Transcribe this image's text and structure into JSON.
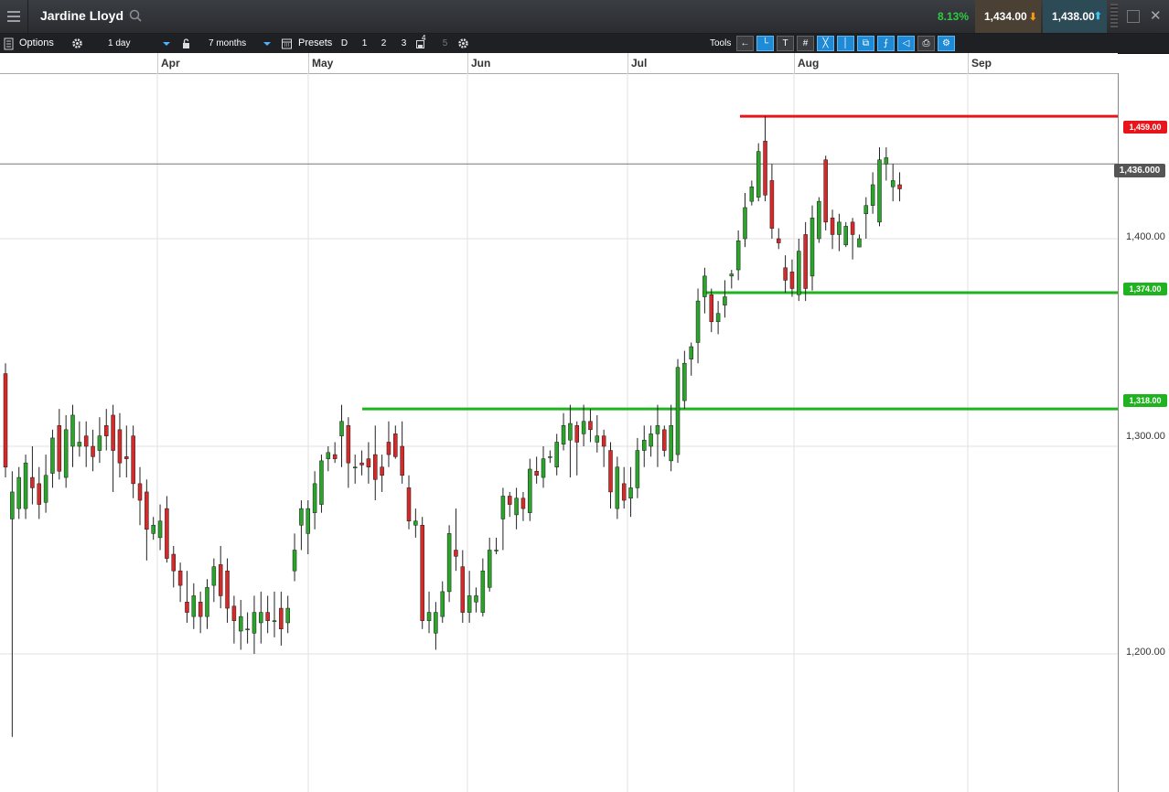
{
  "header": {
    "instrument": "Jardine Lloyd",
    "change_pct": "8.13%",
    "sell_price": "1,434.00",
    "buy_price": "1,438.00"
  },
  "toolbar": {
    "options_label": "Options",
    "interval": "1 day",
    "period": "7 months",
    "presets_label": "Presets",
    "presets": [
      "D",
      "1",
      "2",
      "3",
      "4",
      "5"
    ],
    "tools_label": "Tools"
  },
  "chart_data": {
    "type": "candlestick",
    "x_axis": {
      "months": [
        "Apr",
        "May",
        "Jun",
        "Jul",
        "Aug",
        "Sep"
      ]
    },
    "y_axis": {
      "tick_labels": [
        "1,400.00",
        "1,300.00",
        "1,200.00"
      ],
      "range": [
        1150,
        1500
      ]
    },
    "horizontal_lines": [
      {
        "label": "1,459.00",
        "value": 1459,
        "color": "#e8141b"
      },
      {
        "label": "1,374.00",
        "value": 1374,
        "color": "#1fb41f"
      },
      {
        "label": "1,318.00",
        "value": 1318,
        "color": "#1fb41f"
      }
    ],
    "current_price": {
      "label": "1,436.000",
      "value": 1436
    },
    "candles": [
      [
        1335,
        1290,
        1340,
        1285
      ],
      [
        1265,
        1278,
        1288,
        1160
      ],
      [
        1270,
        1285,
        1290,
        1265
      ],
      [
        1270,
        1292,
        1296,
        1265
      ],
      [
        1285,
        1280,
        1300,
        1272
      ],
      [
        1282,
        1272,
        1290,
        1265
      ],
      [
        1273,
        1286,
        1296,
        1268
      ],
      [
        1287,
        1304,
        1308,
        1280
      ],
      [
        1310,
        1288,
        1318,
        1284
      ],
      [
        1285,
        1308,
        1315,
        1280
      ],
      [
        1300,
        1315,
        1320,
        1290
      ],
      [
        1300,
        1302,
        1312,
        1295
      ],
      [
        1305,
        1300,
        1312,
        1290
      ],
      [
        1300,
        1295,
        1308,
        1288
      ],
      [
        1298,
        1305,
        1314,
        1292
      ],
      [
        1310,
        1305,
        1318,
        1298
      ],
      [
        1315,
        1298,
        1320,
        1278
      ],
      [
        1308,
        1292,
        1316,
        1285
      ],
      [
        1295,
        1294,
        1310,
        1285
      ],
      [
        1305,
        1282,
        1310,
        1275
      ],
      [
        1282,
        1274,
        1290,
        1262
      ],
      [
        1278,
        1260,
        1284,
        1245
      ],
      [
        1258,
        1262,
        1266,
        1255
      ],
      [
        1256,
        1264,
        1272,
        1250
      ],
      [
        1270,
        1246,
        1276,
        1244
      ],
      [
        1248,
        1240,
        1252,
        1232
      ],
      [
        1240,
        1233,
        1244,
        1225
      ],
      [
        1225,
        1220,
        1240,
        1215
      ],
      [
        1218,
        1228,
        1234,
        1212
      ],
      [
        1225,
        1218,
        1230,
        1210
      ],
      [
        1218,
        1232,
        1236,
        1212
      ],
      [
        1233,
        1242,
        1246,
        1225
      ],
      [
        1243,
        1228,
        1252,
        1222
      ],
      [
        1240,
        1222,
        1246,
        1215
      ],
      [
        1223,
        1216,
        1228,
        1205
      ],
      [
        1211,
        1218,
        1226,
        1202
      ],
      [
        1212,
        1212,
        1220,
        1205
      ],
      [
        1210,
        1220,
        1228,
        1200
      ],
      [
        1215,
        1220,
        1230,
        1205
      ],
      [
        1220,
        1216,
        1228,
        1210
      ],
      [
        1216,
        1216,
        1230,
        1208
      ],
      [
        1222,
        1212,
        1230,
        1204
      ],
      [
        1215,
        1222,
        1228,
        1210
      ],
      [
        1240,
        1250,
        1258,
        1235
      ],
      [
        1262,
        1270,
        1274,
        1250
      ],
      [
        1258,
        1270,
        1274,
        1248
      ],
      [
        1268,
        1282,
        1288,
        1260
      ],
      [
        1272,
        1293,
        1296,
        1268
      ],
      [
        1294,
        1297,
        1300,
        1288
      ],
      [
        1296,
        1294,
        1302,
        1292
      ],
      [
        1305,
        1312,
        1320,
        1290
      ],
      [
        1310,
        1292,
        1314,
        1280
      ],
      [
        1290,
        1290,
        1296,
        1282
      ],
      [
        1292,
        1291,
        1298,
        1286
      ],
      [
        1294,
        1290,
        1302,
        1282
      ],
      [
        1296,
        1284,
        1310,
        1274
      ],
      [
        1290,
        1286,
        1296,
        1278
      ],
      [
        1302,
        1296,
        1312,
        1290
      ],
      [
        1306,
        1295,
        1310,
        1294
      ],
      [
        1300,
        1286,
        1312,
        1282
      ],
      [
        1280,
        1264,
        1286,
        1260
      ],
      [
        1262,
        1264,
        1270,
        1256
      ],
      [
        1262,
        1216,
        1266,
        1212
      ],
      [
        1216,
        1220,
        1230,
        1210
      ],
      [
        1210,
        1220,
        1225,
        1202
      ],
      [
        1218,
        1230,
        1235,
        1215
      ],
      [
        1230,
        1258,
        1262,
        1225
      ],
      [
        1250,
        1247,
        1270,
        1240
      ],
      [
        1242,
        1220,
        1250,
        1215
      ],
      [
        1220,
        1228,
        1240,
        1215
      ],
      [
        1225,
        1228,
        1232,
        1220
      ],
      [
        1220,
        1240,
        1246,
        1218
      ],
      [
        1232,
        1250,
        1256,
        1230
      ],
      [
        1250,
        1250,
        1256,
        1248
      ],
      [
        1265,
        1276,
        1280,
        1250
      ],
      [
        1276,
        1272,
        1278,
        1266
      ],
      [
        1267,
        1275,
        1280,
        1260
      ],
      [
        1275,
        1270,
        1278,
        1264
      ],
      [
        1268,
        1289,
        1294,
        1264
      ],
      [
        1288,
        1286,
        1295,
        1282
      ],
      [
        1285,
        1294,
        1300,
        1280
      ],
      [
        1295,
        1295,
        1298,
        1292
      ],
      [
        1290,
        1302,
        1306,
        1286
      ],
      [
        1301,
        1310,
        1316,
        1298
      ],
      [
        1303,
        1311,
        1320,
        1285
      ],
      [
        1310,
        1302,
        1312,
        1286
      ],
      [
        1306,
        1312,
        1320,
        1300
      ],
      [
        1312,
        1308,
        1318,
        1302
      ],
      [
        1302,
        1305,
        1315,
        1297
      ],
      [
        1305,
        1300,
        1308,
        1290
      ],
      [
        1298,
        1278,
        1302,
        1270
      ],
      [
        1270,
        1290,
        1295,
        1265
      ],
      [
        1282,
        1274,
        1290,
        1270
      ],
      [
        1275,
        1280,
        1290,
        1266
      ],
      [
        1280,
        1298,
        1304,
        1275
      ],
      [
        1298,
        1303,
        1310,
        1290
      ],
      [
        1300,
        1306,
        1310,
        1295
      ],
      [
        1306,
        1310,
        1320,
        1290
      ],
      [
        1308,
        1298,
        1310,
        1295
      ],
      [
        1293,
        1310,
        1320,
        1288
      ],
      [
        1296,
        1338,
        1342,
        1292
      ],
      [
        1322,
        1340,
        1346,
        1318
      ],
      [
        1342,
        1348,
        1350,
        1334
      ],
      [
        1350,
        1370,
        1376,
        1340
      ],
      [
        1372,
        1382,
        1386,
        1364
      ],
      [
        1373,
        1360,
        1376,
        1355
      ],
      [
        1360,
        1364,
        1370,
        1354
      ],
      [
        1368,
        1372,
        1380,
        1362
      ],
      [
        1382,
        1383,
        1385,
        1376
      ],
      [
        1385,
        1399,
        1404,
        1380
      ],
      [
        1400,
        1415,
        1422,
        1396
      ],
      [
        1418,
        1425,
        1428,
        1416
      ],
      [
        1420,
        1442,
        1446,
        1418
      ],
      [
        1447,
        1421,
        1459,
        1418
      ],
      [
        1428,
        1405,
        1436,
        1400
      ],
      [
        1400,
        1398,
        1405,
        1395
      ],
      [
        1386,
        1380,
        1392,
        1374
      ],
      [
        1384,
        1376,
        1390,
        1372
      ],
      [
        1373,
        1394,
        1400,
        1370
      ],
      [
        1402,
        1376,
        1408,
        1370
      ],
      [
        1382,
        1410,
        1416,
        1375
      ],
      [
        1400,
        1418,
        1420,
        1398
      ],
      [
        1438,
        1408,
        1440,
        1404
      ],
      [
        1410,
        1402,
        1414,
        1395
      ],
      [
        1402,
        1408,
        1412,
        1394
      ],
      [
        1397,
        1406,
        1408,
        1396
      ],
      [
        1408,
        1402,
        1410,
        1390
      ],
      [
        1396,
        1400,
        1402,
        1396
      ],
      [
        1412,
        1416,
        1420,
        1400
      ],
      [
        1416,
        1426,
        1432,
        1412
      ],
      [
        1408,
        1438,
        1444,
        1406
      ],
      [
        1436,
        1439,
        1444,
        1428
      ],
      [
        1425,
        1428,
        1436,
        1418
      ],
      [
        1426,
        1424,
        1432,
        1418
      ]
    ]
  }
}
